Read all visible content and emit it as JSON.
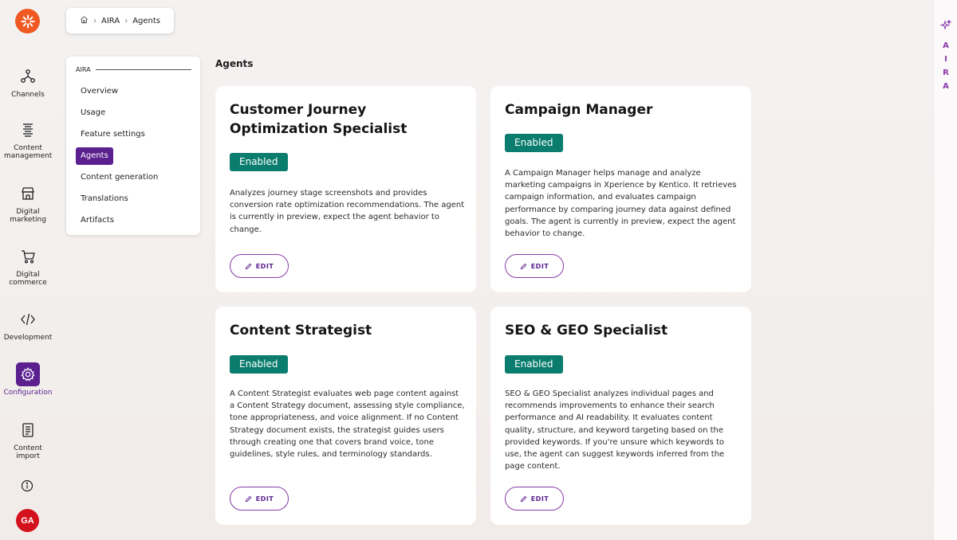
{
  "nav": {
    "items": [
      {
        "name": "channels",
        "label": "Channels",
        "icon": "channels-icon"
      },
      {
        "name": "content-management",
        "label": "Content management",
        "icon": "content-management-icon"
      },
      {
        "name": "digital-marketing",
        "label": "Digital marketing",
        "icon": "storefront-icon"
      },
      {
        "name": "digital-commerce",
        "label": "Digital commerce",
        "icon": "cart-icon"
      },
      {
        "name": "development",
        "label": "Development",
        "icon": "code-icon"
      },
      {
        "name": "configuration",
        "label": "Configuration",
        "icon": "gear-icon",
        "active": true
      },
      {
        "name": "content-import",
        "label": "Content import",
        "icon": "document-icon"
      }
    ],
    "avatar_initials": "GA"
  },
  "breadcrumb": {
    "items": [
      "AIRA",
      "Agents"
    ]
  },
  "submenu": {
    "heading": "AIRA",
    "items": [
      "Overview",
      "Usage",
      "Feature settings",
      "Agents",
      "Content generation",
      "Translations",
      "Artifacts"
    ],
    "active": "Agents"
  },
  "page": {
    "title": "Agents"
  },
  "cards": [
    {
      "title": "Customer Journey Optimization Specialist",
      "status": "Enabled",
      "description": "Analyzes journey stage screenshots and provides conversion rate optimization recommendations. The agent is currently in preview, expect the agent behavior to change.",
      "action": "EDIT"
    },
    {
      "title": "Campaign Manager",
      "status": "Enabled",
      "description": "A Campaign Manager helps manage and analyze marketing campaigns in Xperience by Kentico. It retrieves campaign information, and evaluates campaign performance by comparing journey data against defined goals. The agent is currently in preview, expect the agent behavior to change.",
      "action": "EDIT"
    },
    {
      "title": "Content Strategist",
      "status": "Enabled",
      "description": "A Content Strategist evaluates web page content against a Content Strategy document, assessing style compliance, tone appropriateness, and voice alignment. If no Content Strategy document exists, the strategist guides users through creating one that covers brand voice, tone guidelines, style rules, and terminology standards.",
      "action": "EDIT"
    },
    {
      "title": "SEO & GEO Specialist",
      "status": "Enabled",
      "description": "SEO & GEO Specialist analyzes individual pages and recommends improvements to enhance their search performance and AI readability. It evaluates content quality, structure, and keyword targeting based on the provided keywords. If you're unsure which keywords to use, the agent can suggest keywords inferred from the page content.",
      "action": "EDIT"
    }
  ],
  "rightrail": {
    "letters": [
      "A",
      "I",
      "R",
      "A"
    ]
  },
  "colors": {
    "brand_orange": "#f05a22",
    "accent_purple": "#5b1f8f",
    "enabled_green": "#0b7d6e",
    "avatar_red": "#d3121d"
  }
}
